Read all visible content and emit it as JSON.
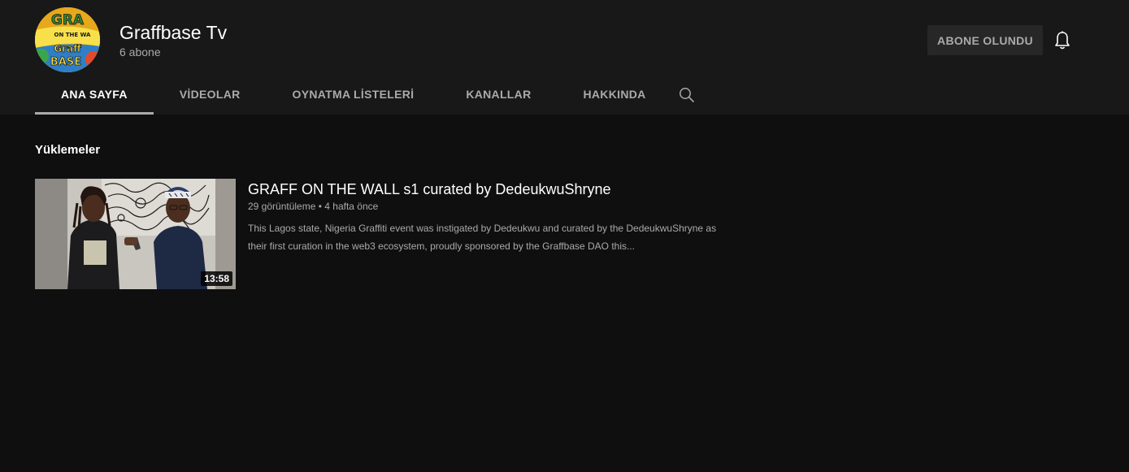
{
  "channel": {
    "name": "Graffbase Tv",
    "subscribers": "6 abone",
    "avatar_icon": "graffiti-logo-avatar",
    "avatar_text_top": "GRAFF",
    "avatar_text_mid": "ON THE WALL",
    "avatar_text_bottom": "Graff base"
  },
  "header": {
    "subscribe_label": "ABONE OLUNDU",
    "bell_icon": "bell-icon"
  },
  "tabs": [
    {
      "label": "ANA SAYFA",
      "active": true
    },
    {
      "label": "VİDEOLAR",
      "active": false
    },
    {
      "label": "OYNATMA LİSTELERİ",
      "active": false
    },
    {
      "label": "KANALLAR",
      "active": false
    },
    {
      "label": "HAKKINDA",
      "active": false
    }
  ],
  "search_icon": "search-icon",
  "section": {
    "title": "Yüklemeler"
  },
  "video": {
    "title": "GRAFF ON THE WALL s1 curated by DedeukwuShryne",
    "views": "29 görüntüleme",
    "separator": "•",
    "age": "4 hafta önce",
    "meta": "29 görüntüleme • 4 hafta önce",
    "description": "This Lagos state, Nigeria Graffiti event was instigated by Dedeukwu and curated by the DedeukwuShryne as their first curation in the web3 ecosystem, proudly sponsored by the Graffbase DAO this...",
    "duration": "13:58"
  },
  "colors": {
    "header_bg": "#181818",
    "page_bg": "#0f0f0f",
    "muted_text": "#aaaaaa",
    "button_bg": "#272727"
  }
}
